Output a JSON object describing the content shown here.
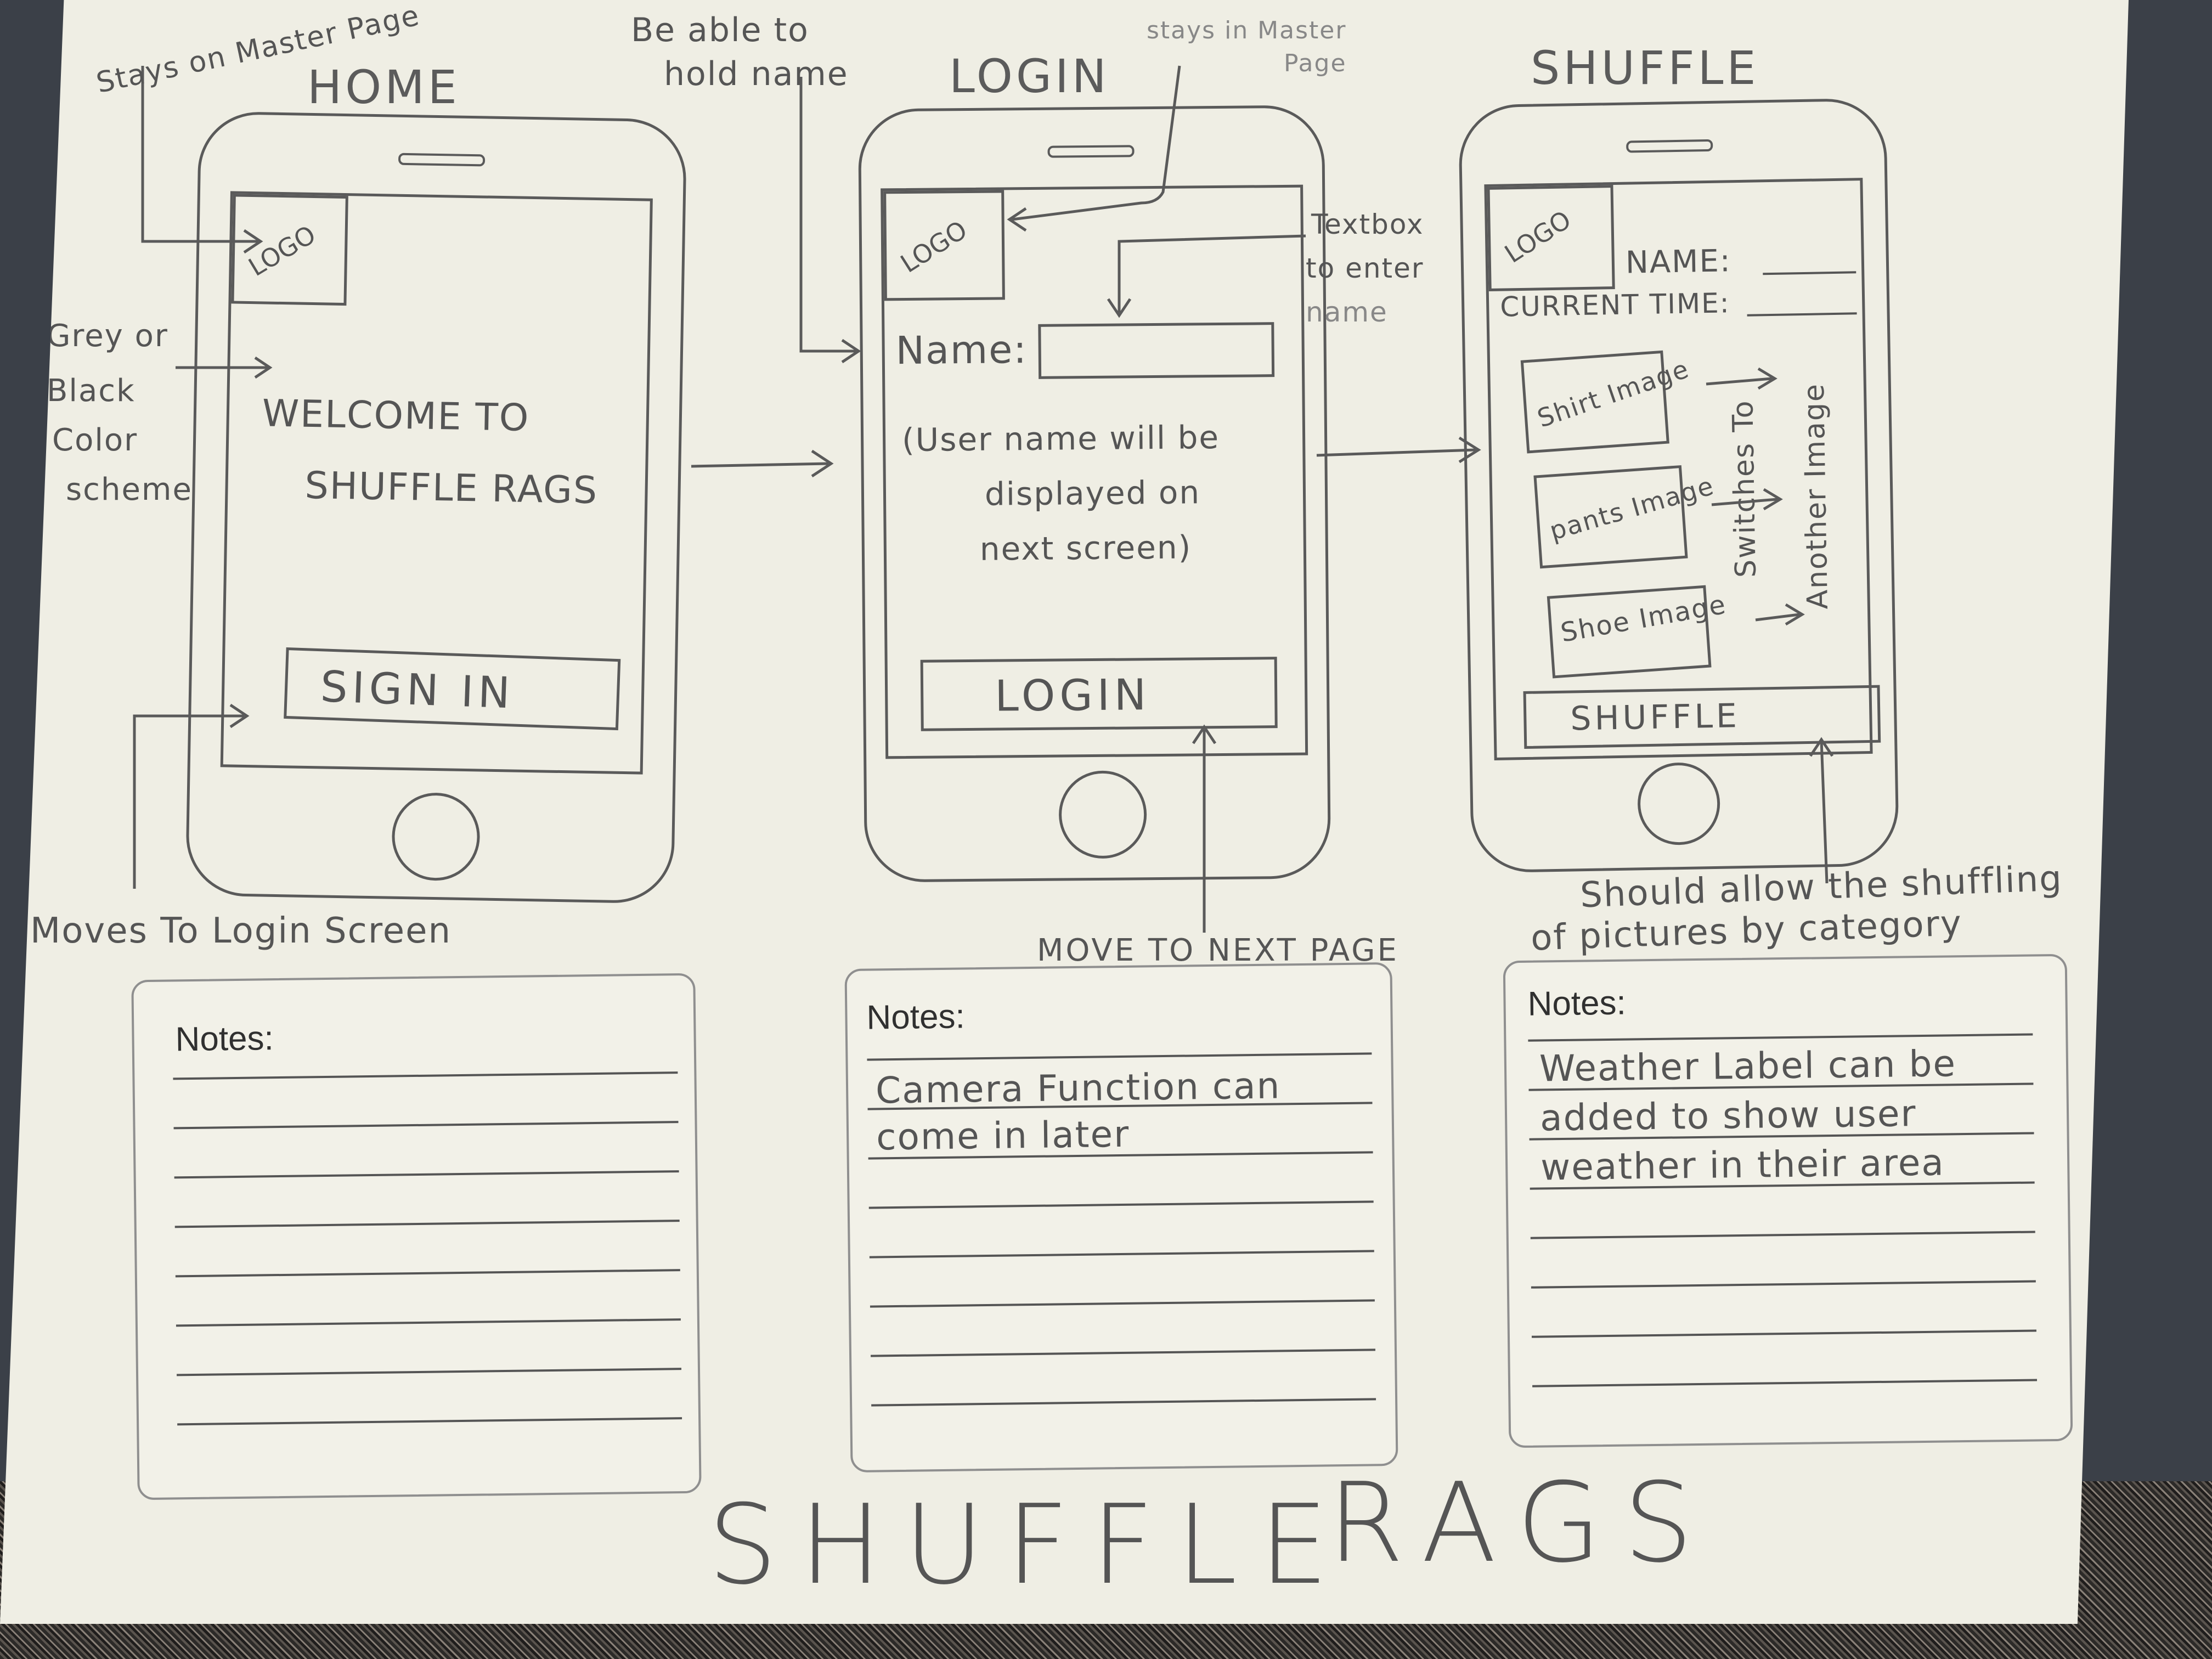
{
  "project_title": [
    "SHUFFLE",
    "RAGS"
  ],
  "screens": {
    "home": {
      "title": "HOME",
      "logo": "LOGO",
      "welcome_line1": "WELCOME TO",
      "welcome_line2": "SHUFFLE RAGS",
      "button": "SIGN IN"
    },
    "login": {
      "title": "LOGIN",
      "logo": "LOGO",
      "name_label": "Name:",
      "hint_line1": "(User name will be",
      "hint_line2": "displayed on",
      "hint_line3": "next screen)",
      "button": "LOGIN"
    },
    "shuffle": {
      "title": "SHUFFLE",
      "logo": "LOGO",
      "name_label": "NAME:",
      "time_label": "CURRENT TIME:",
      "images": [
        "Shirt Image",
        "pants Image",
        "Shoe Image"
      ],
      "side_note_1": "Switches To",
      "side_note_2": "Another Image",
      "button": "SHUFFLE"
    }
  },
  "annotations": {
    "stays_master_1": "Stays on Master Page",
    "color_scheme": [
      "Grey or",
      "Black",
      "Color",
      "scheme"
    ],
    "moves_to_login": "Moves To Login Screen",
    "hold_name": [
      "Be able to",
      "hold name"
    ],
    "stays_master_2": [
      "stays in Master",
      "Page"
    ],
    "textbox": [
      "Textbox",
      "to enter",
      "name"
    ],
    "move_next": "MOVE TO NEXT PAGE",
    "shuffle_note": [
      "Should allow the shuffling",
      "of pictures by category"
    ]
  },
  "notes": {
    "label": "Notes:",
    "login_notes": [
      "Camera Function can",
      "come in later"
    ],
    "shuffle_notes": [
      "Weather Label can be",
      "added to show user",
      "weather in their area"
    ]
  }
}
